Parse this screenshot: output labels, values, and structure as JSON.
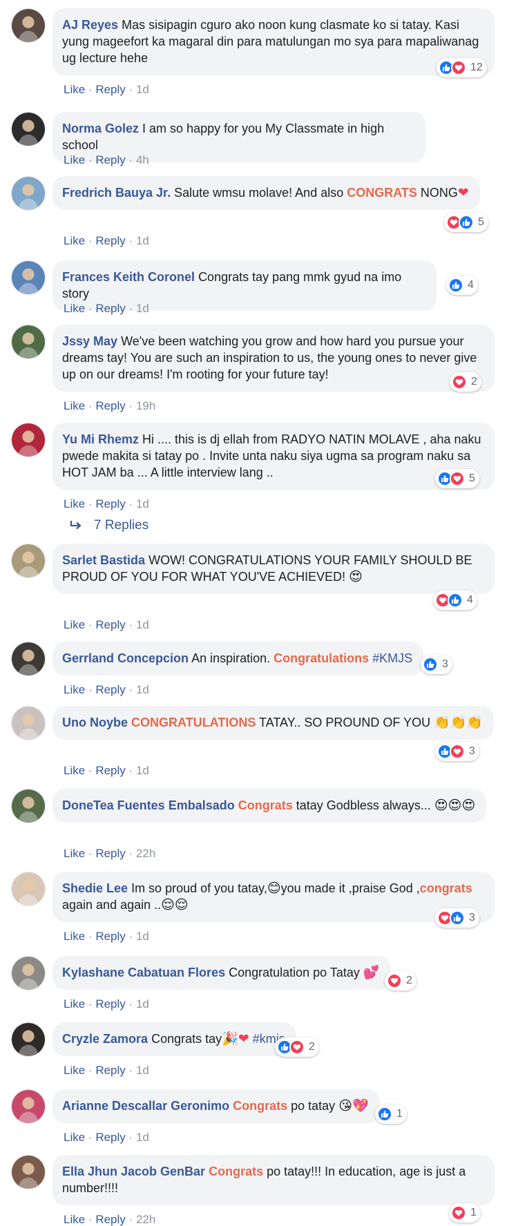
{
  "actions": {
    "like": "Like",
    "reply": "Reply",
    "dot": "·"
  },
  "colors": {
    "link": "#385898",
    "highlight": "#e8684a",
    "like": "#1877f2",
    "love": "#f33e58",
    "bubble": "#f2f3f5"
  },
  "comments": [
    {
      "author": "AJ Reyes",
      "time": "1d",
      "avatar": "#5a4a44",
      "parts": [
        {
          "t": "Mas sisipagin cguro ako noon kung clasmate ko si tatay. Kasi yung mageefort ka magaral din para matulungan mo sya para mapaliwanag ug lecture hehe"
        }
      ],
      "reactions": [
        "like-icon",
        "love-icon"
      ],
      "count": "12"
    },
    {
      "author": "Norma Golez",
      "time": "4h",
      "avatar": "#2b2b2b",
      "parts": [
        {
          "t": "I am so happy for you My Classmate in high school"
        }
      ],
      "reactions": [],
      "count": ""
    },
    {
      "author": "Fredrich Bauya Jr.",
      "time": "1d",
      "avatar": "#7fa7c9",
      "parts": [
        {
          "t": "Salute wmsu molave! And also "
        },
        {
          "t": "CONGRATS",
          "c": "hl"
        },
        {
          "t": " NONG"
        },
        {
          "t": "❤",
          "c": "emo heart"
        }
      ],
      "reactions": [
        "love-icon",
        "like-icon"
      ],
      "count": "5"
    },
    {
      "author": "Frances Keith Coronel",
      "time": "1d",
      "avatar": "#5b84b8",
      "parts": [
        {
          "t": "Congrats tay pang mmk gyud na imo story"
        }
      ],
      "reactions": [
        "like-icon"
      ],
      "count": "4"
    },
    {
      "author": "Jssy May",
      "time": "19h",
      "avatar": "#4f6b45",
      "parts": [
        {
          "t": "We've been watching you grow and how hard you pursue your dreams tay! You are such an inspiration to us, the young ones to never give up on our dreams! I'm rooting for your future tay!"
        }
      ],
      "reactions": [
        "love-icon"
      ],
      "count": "2"
    },
    {
      "author": "Yu Mi Rhemz",
      "time": "1d",
      "avatar": "#b2263c",
      "parts": [
        {
          "t": "Hi .... this is dj ellah from RADYO NATIN MOLAVE , aha naku pwede makita si tatay po . Invite unta naku siya ugma sa program naku sa HOT JAM ba ... A little interview lang .."
        }
      ],
      "reactions": [
        "like-icon",
        "love-icon"
      ],
      "count": "5"
    },
    {
      "author": "Sarlet Bastida",
      "time": "1d",
      "avatar": "#a89b7a",
      "parts": [
        {
          "t": "WOW! CONGRATULATIONS YOUR FAMILY SHOULD BE PROUD OF YOU FOR WHAT YOU'VE ACHIEVED! "
        },
        {
          "t": "😍",
          "c": "emo"
        }
      ],
      "reactions": [
        "love-icon",
        "like-icon"
      ],
      "count": "4"
    },
    {
      "author": "Gerrland Concepcion",
      "time": "1d",
      "avatar": "#3d3a36",
      "parts": [
        {
          "t": "An inspiration. "
        },
        {
          "t": "Congratulations",
          "c": "hl"
        },
        {
          "t": " "
        },
        {
          "t": "#KMJS",
          "c": "tag"
        }
      ],
      "reactions": [
        "like-icon"
      ],
      "count": "3"
    },
    {
      "author": "Uno Noybe",
      "time": "1d",
      "avatar": "#c9c2c0",
      "parts": [
        {
          "t": "CONGRATULATIONS",
          "c": "hl"
        },
        {
          "t": " TATAY.. SO PROUND OF YOU "
        },
        {
          "t": "👏👏👏",
          "c": "emo"
        }
      ],
      "reactions": [
        "like-icon",
        "love-icon"
      ],
      "count": "3"
    },
    {
      "author": "DoneTea Fuentes Embalsado",
      "time": "22h",
      "avatar": "#556b4a",
      "parts": [
        {
          "t": "Congrats",
          "c": "hl"
        },
        {
          "t": " tatay Godbless always... "
        },
        {
          "t": "😍😍😍",
          "c": "emo"
        }
      ],
      "reactions": [],
      "count": ""
    },
    {
      "author": "Shedie Lee",
      "time": "1d",
      "avatar": "#d9c7b5",
      "parts": [
        {
          "t": "Im so proud of you tatay,"
        },
        {
          "t": "😊",
          "c": "emo"
        },
        {
          "t": "you made it ,praise God ,"
        },
        {
          "t": "congrats",
          "c": "hl"
        },
        {
          "t": " again and again .."
        },
        {
          "t": "😌😌",
          "c": "emo"
        }
      ],
      "reactions": [
        "love-icon",
        "like-icon"
      ],
      "count": "3"
    },
    {
      "author": "Kylashane Cabatuan Flores",
      "time": "1d",
      "avatar": "#8d8a85",
      "parts": [
        {
          "t": "Congratulation po Tatay "
        },
        {
          "t": "💕",
          "c": "emo"
        }
      ],
      "reactions": [
        "love-icon"
      ],
      "count": "2"
    },
    {
      "author": "Cryzle Zamora",
      "time": "1d",
      "avatar": "#2e2a28",
      "parts": [
        {
          "t": "Congrats tay"
        },
        {
          "t": "🎉",
          "c": "emo"
        },
        {
          "t": "❤",
          "c": "emo heart"
        },
        {
          "t": " "
        },
        {
          "t": "#kmjs",
          "c": "tag"
        }
      ],
      "reactions": [
        "like-icon",
        "love-icon"
      ],
      "count": "2"
    },
    {
      "author": "Arianne Descallar Geronimo",
      "time": "1d",
      "avatar": "#c74a6b",
      "parts": [
        {
          "t": "Congrats",
          "c": "hl"
        },
        {
          "t": " po tatay "
        },
        {
          "t": "😘💖",
          "c": "emo"
        }
      ],
      "reactions": [
        "like-icon"
      ],
      "count": "1"
    },
    {
      "author": "Ella Jhun Jacob GenBar",
      "time": "22h",
      "avatar": "#7a5a4a",
      "parts": [
        {
          "t": "Congrats",
          "c": "hl"
        },
        {
          "t": " po tatay!!! In education, age is just a number!!!!"
        }
      ],
      "reactions": [
        "love-icon"
      ],
      "count": "1"
    }
  ],
  "replies_link": {
    "label": "7 Replies"
  }
}
